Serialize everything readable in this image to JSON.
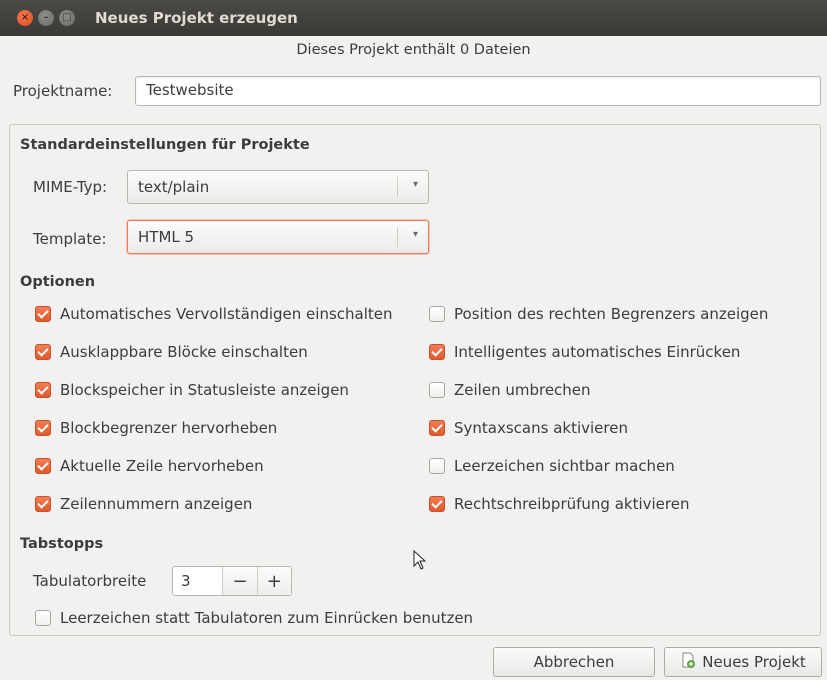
{
  "window": {
    "title": "Neues Projekt erzeugen",
    "close_icon_glyph": "×",
    "min_icon_glyph": "–",
    "max_icon_glyph": "□"
  },
  "info": "Dieses Projekt enthält 0 Dateien",
  "project": {
    "label": "Projektname:",
    "value": "Testwebsite"
  },
  "defaults": {
    "heading": "Standardeinstellungen für Projekte",
    "mime_label": "MIME-Typ:",
    "mime_value": "text/plain",
    "template_label": "Template:",
    "template_value": "HTML 5",
    "dropdown_icon": "▾"
  },
  "options": {
    "heading": "Optionen",
    "left": [
      {
        "label": "Automatisches Vervollständigen einschalten",
        "checked": true
      },
      {
        "label": "Ausklappbare Blöcke einschalten",
        "checked": true
      },
      {
        "label": "Blockspeicher in Statusleiste anzeigen",
        "checked": true
      },
      {
        "label": "Blockbegrenzer hervorheben",
        "checked": true
      },
      {
        "label": "Aktuelle Zeile hervorheben",
        "checked": true
      },
      {
        "label": "Zeilennummern anzeigen",
        "checked": true
      }
    ],
    "right": [
      {
        "label": "Position des rechten Begrenzers anzeigen",
        "checked": false
      },
      {
        "label": "Intelligentes automatisches Einrücken",
        "checked": true
      },
      {
        "label": "Zeilen umbrechen",
        "checked": false
      },
      {
        "label": "Syntaxscans aktivieren",
        "checked": true
      },
      {
        "label": "Leerzeichen sichtbar machen",
        "checked": false
      },
      {
        "label": "Rechtschreibprüfung aktivieren",
        "checked": true
      }
    ]
  },
  "tabs": {
    "heading": "Tabstopps",
    "width_label": "Tabulatorbreite",
    "width_value": "3",
    "minus": "−",
    "plus": "+",
    "spaces_label": "Leerzeichen statt Tabulatoren zum Einrücken benutzen",
    "spaces_checked": false
  },
  "buttons": {
    "cancel": "Abbrechen",
    "create": "Neues Projekt"
  },
  "colors": {
    "accent": "#df5a2c",
    "titlebar": "#3c3b37"
  }
}
